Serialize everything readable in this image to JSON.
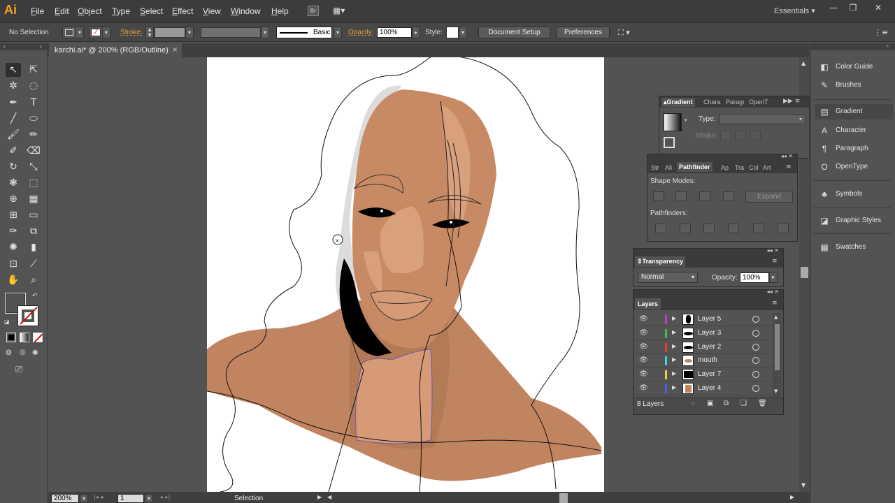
{
  "app": {
    "logo": "Ai",
    "menu": [
      "File",
      "Edit",
      "Object",
      "Type",
      "Select",
      "Effect",
      "View",
      "Window",
      "Help"
    ],
    "workspace": "Essentials",
    "window_buttons": {
      "minimize": "—",
      "restore": "❐",
      "close": "✕"
    }
  },
  "control_bar": {
    "selection": "No Selection",
    "stroke_label": "Stroke:",
    "brush_label": "Basic",
    "opacity_label": "Opacity:",
    "opacity_value": "100%",
    "style_label": "Style:",
    "document_setup": "Document Setup",
    "preferences": "Preferences"
  },
  "document": {
    "tab_title": "karchi.ai* @ 200% (RGB/Outline)",
    "close": "×"
  },
  "status_bar": {
    "zoom": "200%",
    "artboard": "1",
    "tool": "Selection"
  },
  "dock": {
    "items": [
      {
        "label": "Color Guide",
        "icon": "color-guide-icon",
        "glyph": "◧"
      },
      {
        "label": "Brushes",
        "icon": "brush-icon",
        "glyph": "✎"
      },
      {
        "label": "Gradient",
        "icon": "gradient-icon",
        "glyph": "▤"
      },
      {
        "label": "Character",
        "icon": "character-icon",
        "glyph": "A"
      },
      {
        "label": "Paragraph",
        "icon": "paragraph-icon",
        "glyph": "¶"
      },
      {
        "label": "OpenType",
        "icon": "opentype-icon",
        "glyph": "O"
      },
      {
        "label": "Symbols",
        "icon": "symbols-icon",
        "glyph": "♣"
      },
      {
        "label": "Graphic Styles",
        "icon": "graphic-styles-icon",
        "glyph": "◪"
      },
      {
        "label": "Swatches",
        "icon": "swatches-icon",
        "glyph": "▦"
      }
    ]
  },
  "gradient_panel": {
    "tabs": [
      "Gradient",
      "Chara",
      "Paragı",
      "OpenT"
    ],
    "type_label": "Type:",
    "stroke_label": "Stroke:"
  },
  "pathfinder_panel": {
    "tabs": [
      "Str",
      "Ali",
      "Pathfinder",
      "Ap",
      "Tra",
      "Col",
      "Art"
    ],
    "shape_modes": "Shape Modes:",
    "expand": "Expand",
    "pathfinders": "Pathfinders:"
  },
  "transparency_panel": {
    "title": "Transparency",
    "blend_mode": "Normal",
    "opacity_label": "Opacity:",
    "opacity_value": "100%"
  },
  "layers_panel": {
    "title": "Layers",
    "layers": [
      {
        "name": "Layer 5",
        "color": "#c23ec9"
      },
      {
        "name": "Layer 3",
        "color": "#3fbf3f"
      },
      {
        "name": "Layer 2",
        "color": "#e04040"
      },
      {
        "name": "mouth",
        "color": "#3fd7e8"
      },
      {
        "name": "Layer 7",
        "color": "#e8d23f"
      },
      {
        "name": "Layer 4",
        "color": "#4a5ee8"
      }
    ],
    "count": "8 Layers"
  },
  "colors": {
    "accent_orange": "#f7a21b",
    "skin_dark": "#c08460",
    "skin_mid": "#cf9573",
    "skin_light": "#d9a07e",
    "hair": "#000000"
  }
}
